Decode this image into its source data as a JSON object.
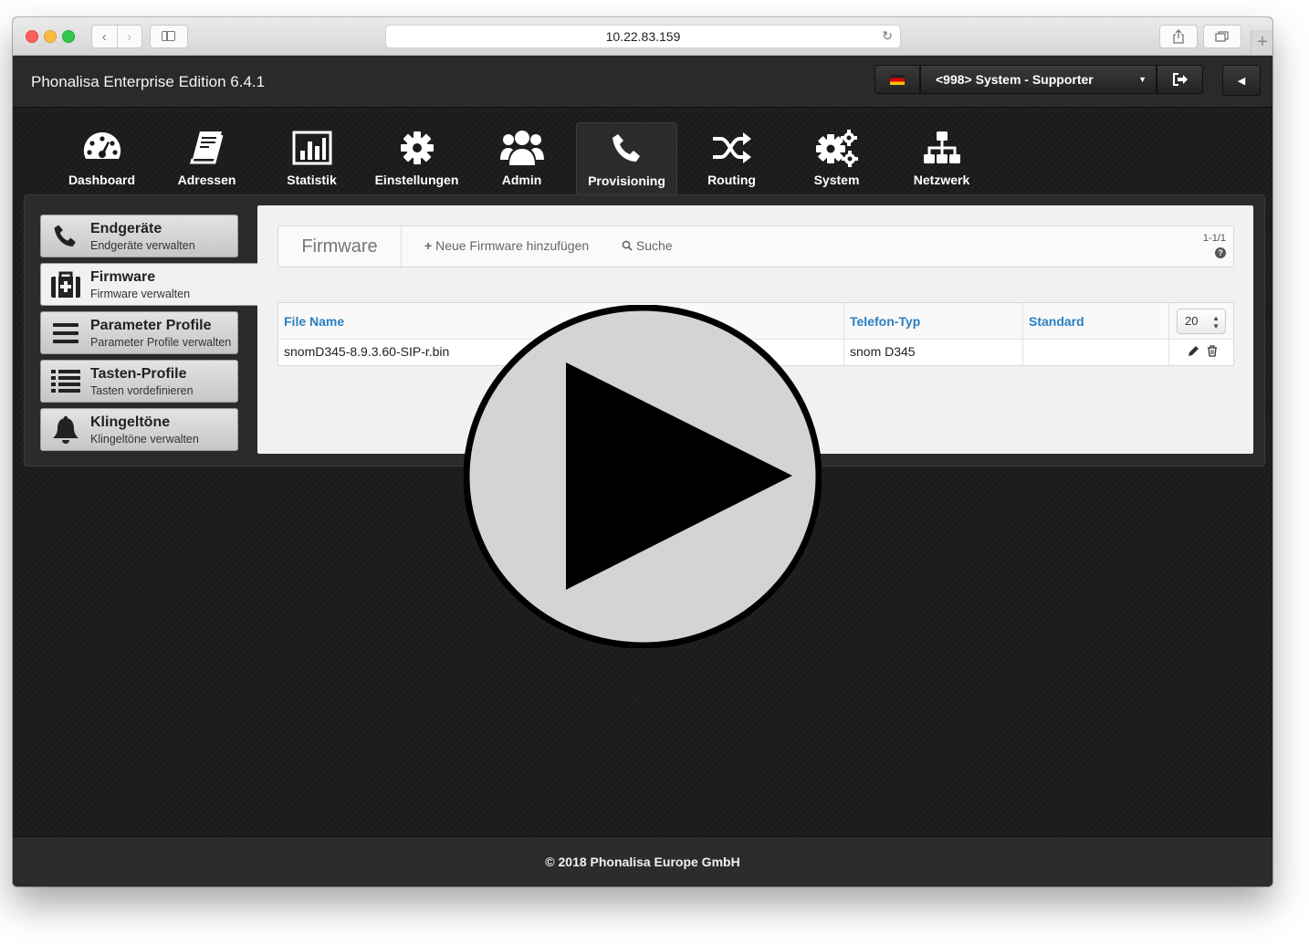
{
  "browser": {
    "url": "10.22.83.159"
  },
  "app": {
    "title": "Phonalisa Enterprise Edition 6.4.1",
    "user_label": "<998> System - Supporter"
  },
  "nav": {
    "items": [
      {
        "label": "Dashboard",
        "icon": "dashboard-icon"
      },
      {
        "label": "Adressen",
        "icon": "address-book-icon"
      },
      {
        "label": "Statistik",
        "icon": "statistics-icon"
      },
      {
        "label": "Einstellungen",
        "icon": "gear-icon"
      },
      {
        "label": "Admin",
        "icon": "users-icon"
      },
      {
        "label": "Provisioning",
        "icon": "phone-icon"
      },
      {
        "label": "Routing",
        "icon": "shuffle-icon"
      },
      {
        "label": "System",
        "icon": "gears-icon"
      },
      {
        "label": "Netzwerk",
        "icon": "sitemap-icon"
      }
    ],
    "active": "Provisioning"
  },
  "sidebar": {
    "items": [
      {
        "title": "Endgeräte",
        "subtitle": "Endgeräte verwalten",
        "icon": "phone-icon"
      },
      {
        "title": "Firmware",
        "subtitle": "Firmware verwalten",
        "icon": "medkit-icon"
      },
      {
        "title": "Parameter Profile",
        "subtitle": "Parameter Profile verwalten",
        "icon": "bars-icon"
      },
      {
        "title": "Tasten-Profile",
        "subtitle": "Tasten vordefinieren",
        "icon": "list-icon"
      },
      {
        "title": "Klingeltöne",
        "subtitle": "Klingeltöne verwalten",
        "icon": "bell-icon"
      }
    ],
    "active": "Firmware"
  },
  "toolbar": {
    "title": "Firmware",
    "add_label": "Neue Firmware hinzufügen",
    "search_label": "Suche",
    "count": "1-1/1"
  },
  "table": {
    "columns": [
      "File Name",
      "Telefon-Typ",
      "Standard"
    ],
    "page_size": "20",
    "rows": [
      {
        "file_name": "snomD345-8.9.3.60-SIP-r.bin",
        "telefon_typ": "snom D345",
        "standard": ""
      }
    ]
  },
  "footer": {
    "copyright": "© 2018 Phonalisa Europe GmbH"
  },
  "colors": {
    "link_blue": "#2a7fc1",
    "header_dark": "#2a2a2a"
  }
}
